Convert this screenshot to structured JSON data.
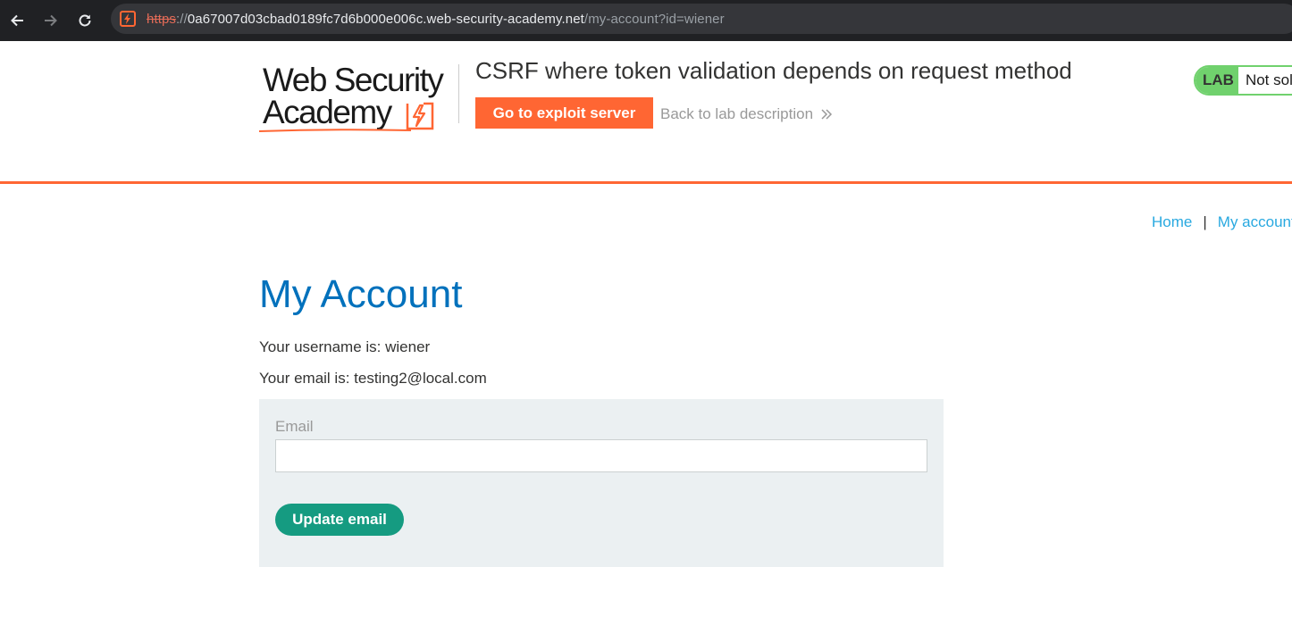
{
  "browser": {
    "url_scheme": "https",
    "url_separator": "://",
    "url_host": "0a67007d03cbad0189fc7d6b000e006c.web-security-academy.net",
    "url_path": "/my-account?id=wiener"
  },
  "header": {
    "logo_line1": "Web Security",
    "logo_line2": "Academy",
    "lab_title": "CSRF where token validation depends on request method",
    "exploit_button": "Go to exploit server",
    "back_link": "Back to lab description",
    "lab_badge": "LAB",
    "lab_status": "Not solved"
  },
  "nav": {
    "home": "Home",
    "separator": "|",
    "my_account": "My account"
  },
  "main": {
    "title": "My Account",
    "username_line": "Your username is: wiener",
    "email_line": "Your email is: testing2@local.com",
    "form": {
      "email_label": "Email",
      "email_value": "",
      "submit_label": "Update email"
    }
  },
  "colors": {
    "accent_orange": "#ff6633",
    "heading_blue": "#0071bc",
    "lab_green": "#70d16d",
    "button_teal": "#159b81"
  }
}
